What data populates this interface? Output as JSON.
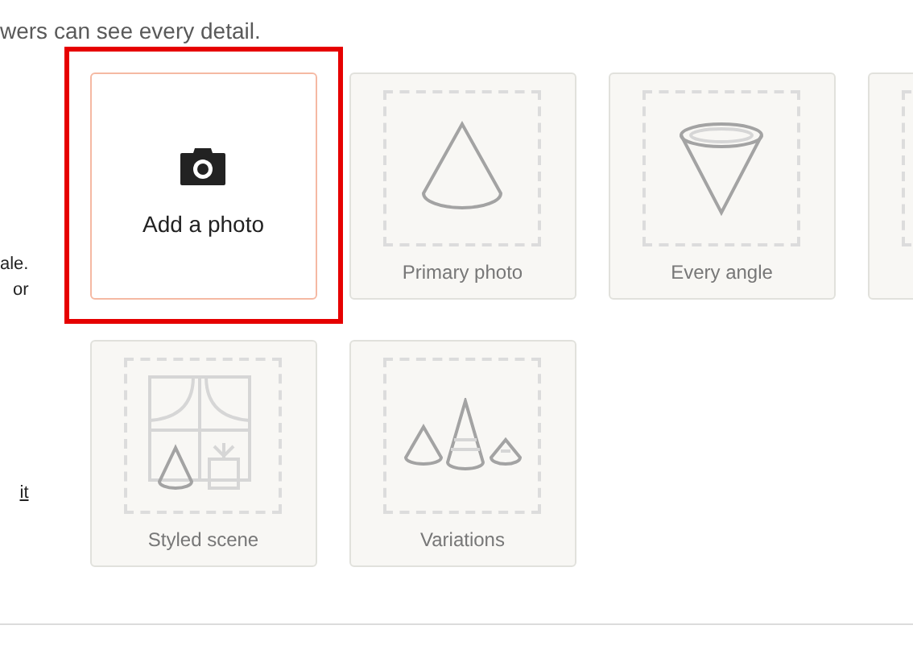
{
  "intro": "wers can see every detail.",
  "side_texts": [
    {
      "kind": "text",
      "text": "ale."
    },
    {
      "kind": "text",
      "text": "or"
    },
    {
      "kind": "link",
      "text": "it"
    }
  ],
  "tiles": [
    {
      "kind": "add",
      "label": "Add a photo",
      "selected": true
    },
    {
      "kind": "primary",
      "label": "Primary photo",
      "selected": false
    },
    {
      "kind": "angle",
      "label": "Every angle",
      "selected": false
    },
    {
      "kind": "blank",
      "selected": false
    },
    {
      "kind": "scene",
      "label": "Styled scene",
      "selected": false
    },
    {
      "kind": "variations",
      "label": "Variations",
      "selected": false
    }
  ]
}
